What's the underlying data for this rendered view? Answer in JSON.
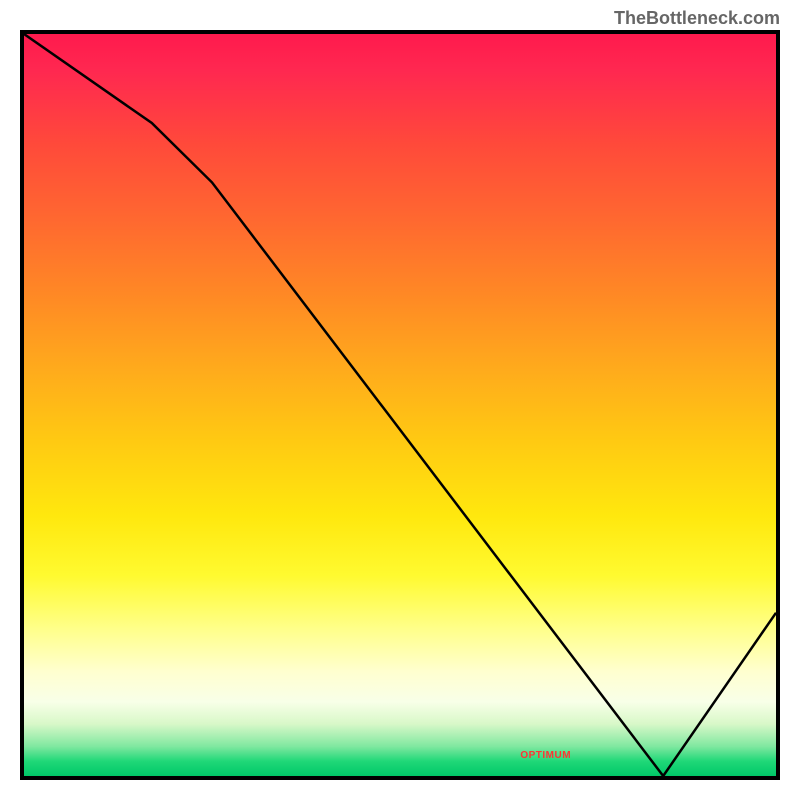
{
  "watermark": "TheBottleneck.com",
  "chart_data": {
    "type": "line",
    "title": "",
    "xlabel": "",
    "ylabel": "",
    "x": [
      0,
      17,
      25,
      85,
      100
    ],
    "values": [
      100,
      88,
      80,
      0,
      22
    ],
    "xlim": [
      0,
      100
    ],
    "ylim": [
      0,
      100
    ],
    "background_gradient": {
      "top": "#ff1a4d",
      "middle": "#ffe80e",
      "bottom": "#00c868"
    },
    "optimal_region_label": "OPTIMUM",
    "optimal_region_x": 85
  },
  "colors": {
    "border": "#000000",
    "line": "#000000",
    "watermark": "#666666",
    "label": "#ff3333"
  }
}
